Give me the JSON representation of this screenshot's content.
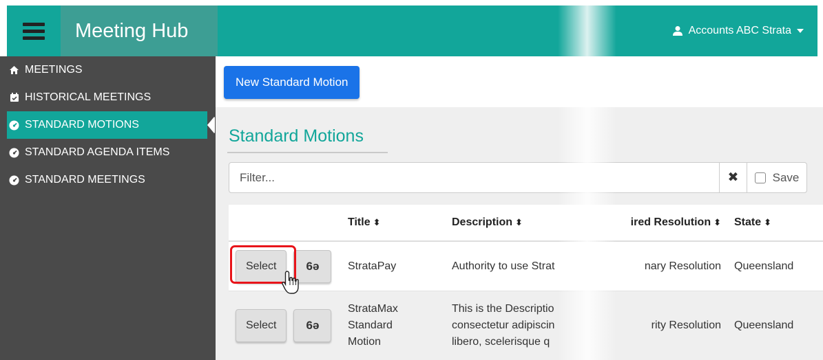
{
  "header": {
    "brand": "Meeting Hub",
    "account_label": "Accounts ABC Strata",
    "menu_icon": "hamburger-icon",
    "user_icon": "user-icon",
    "accent": "#12a69a"
  },
  "sidebar": {
    "items": [
      {
        "label": "MEETINGS",
        "icon": "home-icon",
        "active": false
      },
      {
        "label": "HISTORICAL MEETINGS",
        "icon": "calendar-icon",
        "active": false
      },
      {
        "label": "STANDARD MOTIONS",
        "icon": "gauge-icon",
        "active": true
      },
      {
        "label": "STANDARD AGENDA ITEMS",
        "icon": "gauge-icon",
        "active": false
      },
      {
        "label": "STANDARD MEETINGS",
        "icon": "gauge-icon",
        "active": false
      }
    ]
  },
  "toolbar": {
    "new_button": "New Standard Motion"
  },
  "page": {
    "title": "Standard Motions"
  },
  "filter": {
    "placeholder": "Filter...",
    "clear": "✖",
    "save_label": "Save"
  },
  "table": {
    "columns": [
      "Title",
      "Description",
      "ired Resolution",
      "State"
    ],
    "sort_icon": "⬍",
    "rows": [
      {
        "select": "Select",
        "view_icon": "glasses-icon",
        "title": "StrataPay",
        "description": "Authority to use Strat",
        "resolution": "nary Resolution",
        "state": "Queensland"
      },
      {
        "select": "Select",
        "view_icon": "glasses-icon",
        "title": "StrataMax Standard Motion",
        "description_lines": [
          "This is the Descriptio",
          "consectetur adipiscin",
          "libero, scelerisque q"
        ],
        "resolution": "rity Resolution",
        "state": "Queensland"
      }
    ]
  },
  "colors": {
    "primary_button": "#1a73e8",
    "sidebar": "#4a4a4a",
    "highlight": "#e8141a"
  }
}
